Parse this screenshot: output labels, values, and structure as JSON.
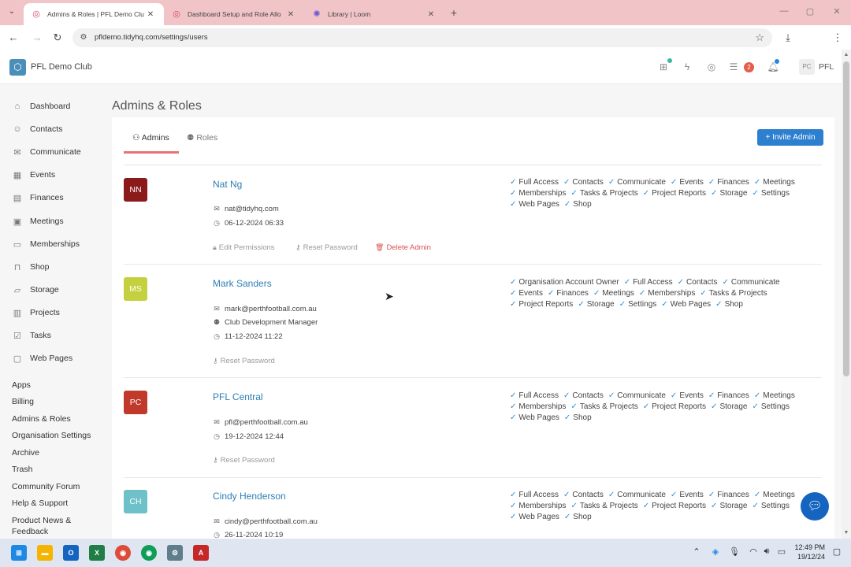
{
  "browser": {
    "tabs": [
      {
        "title": "Admins & Roles | PFL Demo Clu"
      },
      {
        "title": "Dashboard Setup and Role Allo"
      },
      {
        "title": "Library | Loom"
      }
    ],
    "url": "pfldemo.tidyhq.com/settings/users"
  },
  "header": {
    "club_name": "PFL Demo Club",
    "notification_count": "2",
    "avatar_initials": "PC",
    "user_label": "PFL"
  },
  "sidebar": {
    "items": [
      {
        "label": "Dashboard",
        "icon": "home-icon"
      },
      {
        "label": "Contacts",
        "icon": "contacts-icon"
      },
      {
        "label": "Communicate",
        "icon": "chat-icon"
      },
      {
        "label": "Events",
        "icon": "calendar-icon"
      },
      {
        "label": "Finances",
        "icon": "finance-icon"
      },
      {
        "label": "Meetings",
        "icon": "meetings-icon"
      },
      {
        "label": "Memberships",
        "icon": "memberships-icon"
      },
      {
        "label": "Shop",
        "icon": "shop-icon"
      },
      {
        "label": "Storage",
        "icon": "folder-icon"
      },
      {
        "label": "Projects",
        "icon": "projects-icon"
      },
      {
        "label": "Tasks",
        "icon": "tasks-icon"
      },
      {
        "label": "Web Pages",
        "icon": "webpages-icon"
      }
    ],
    "links": [
      "Apps",
      "Billing",
      "Admins & Roles",
      "Organisation Settings",
      "Archive",
      "Trash",
      "Community Forum",
      "Help & Support",
      "Product News &",
      "Feedback"
    ]
  },
  "main": {
    "title": "Admins & Roles",
    "tabs": {
      "admins": "Admins",
      "roles": "Roles"
    },
    "invite_label": "+ Invite Admin",
    "actions": {
      "edit": "Edit Permissions",
      "reset": "Reset Password",
      "delete": "Delete Admin"
    },
    "admins": [
      {
        "initials": "NN",
        "avatar_color": "#8b1a1a",
        "name": "Nat Ng",
        "email": "nat@tidyhq.com",
        "date": "06-12-2024 06:33",
        "permissions": [
          "Full Access",
          "Contacts",
          "Communicate",
          "Events",
          "Finances",
          "Meetings",
          "Memberships",
          "Tasks & Projects",
          "Project Reports",
          "Storage",
          "Settings",
          "Web Pages",
          "Shop"
        ]
      },
      {
        "initials": "MS",
        "avatar_color": "#c5d03f",
        "name": "Mark Sanders",
        "email": "mark@perthfootball.com.au",
        "role": "Club Development Manager",
        "date": "11-12-2024 11:22",
        "permissions": [
          "Organisation Account Owner",
          "Full Access",
          "Contacts",
          "Communicate",
          "Events",
          "Finances",
          "Meetings",
          "Memberships",
          "Tasks & Projects",
          "Project Reports",
          "Storage",
          "Settings",
          "Web Pages",
          "Shop"
        ]
      },
      {
        "initials": "PC",
        "avatar_color": "#c0392b",
        "name": "PFL Central",
        "email": "pfl@perthfootball.com.au",
        "date": "19-12-2024 12:44",
        "permissions": [
          "Full Access",
          "Contacts",
          "Communicate",
          "Events",
          "Finances",
          "Meetings",
          "Memberships",
          "Tasks & Projects",
          "Project Reports",
          "Storage",
          "Settings",
          "Web Pages",
          "Shop"
        ]
      },
      {
        "initials": "CH",
        "avatar_color": "#6ec1c9",
        "name": "Cindy Henderson",
        "email": "cindy@perthfootball.com.au",
        "date": "26-11-2024 10:19",
        "permissions": [
          "Full Access",
          "Contacts",
          "Communicate",
          "Events",
          "Finances",
          "Meetings",
          "Memberships",
          "Tasks & Projects",
          "Project Reports",
          "Storage",
          "Settings",
          "Web Pages",
          "Shop"
        ]
      }
    ]
  },
  "taskbar": {
    "time": "12:49 PM",
    "date": "19/12/24"
  }
}
